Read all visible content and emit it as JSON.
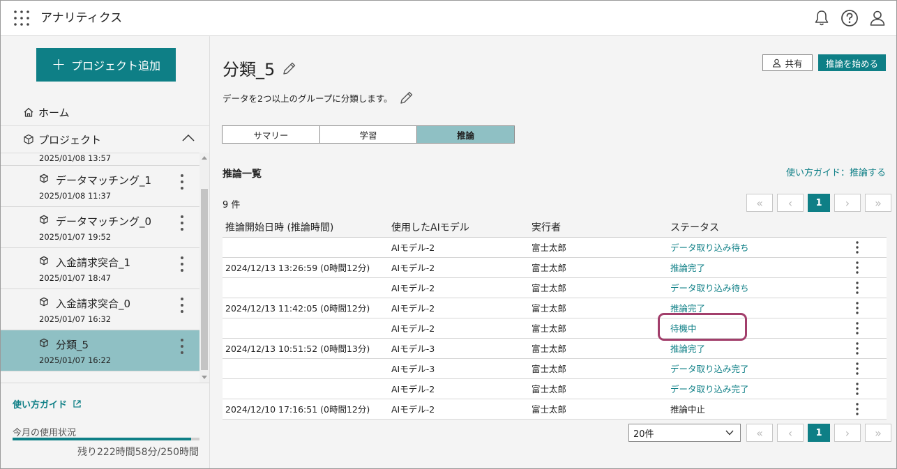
{
  "app": {
    "title": "アナリティクス"
  },
  "colors": {
    "accent": "#0e7f86",
    "active_bg": "#8fc0c4",
    "highlight": "#a23e6b"
  },
  "header": {
    "icons": [
      "apps-grid-icon",
      "bell-icon",
      "help-icon",
      "user-icon"
    ]
  },
  "sidebar": {
    "add_project": "プロジェクト追加",
    "home": "ホーム",
    "projects": "プロジェクト",
    "partial_date": "2025/01/08 13:57",
    "items": [
      {
        "name": "データマッチング_1",
        "date": "2025/01/08 11:37"
      },
      {
        "name": "データマッチング_0",
        "date": "2025/01/07 19:52"
      },
      {
        "name": "入金請求突合_1",
        "date": "2025/01/07 18:47"
      },
      {
        "name": "入金請求突合_0",
        "date": "2025/01/07 16:32"
      },
      {
        "name": "分類_5",
        "date": "2025/01/07 16:22"
      }
    ],
    "guide": "使い方ガイド",
    "usage_label": "今月の使用状況",
    "usage_fraction": 0.957,
    "usage_remain": "残り222時間58分/250時間"
  },
  "main": {
    "project_title": "分類_5",
    "description": "データを2つ以上のグループに分類します。",
    "share": "共有",
    "start": "推論を始める",
    "tabs": [
      "サマリー",
      "学習",
      "推論"
    ],
    "section_title": "推論一覧",
    "guide_link": "使い方ガイド：推論する",
    "count": "9 件",
    "current_page": "1",
    "per_page": "20件",
    "columns": [
      "推論開始日時 (推論時間)",
      "使用したAIモデル",
      "実行者",
      "ステータス"
    ],
    "rows": [
      {
        "start": "",
        "model": "AIモデル-2",
        "user": "富士太郎",
        "status": "データ取り込み待ち"
      },
      {
        "start": "2024/12/13 13:26:59 (0時間12分)",
        "model": "AIモデル-2",
        "user": "富士太郎",
        "status": "推論完了"
      },
      {
        "start": "",
        "model": "AIモデル-2",
        "user": "富士太郎",
        "status": "データ取り込み待ち"
      },
      {
        "start": "2024/12/13 11:42:05 (0時間12分)",
        "model": "AIモデル-2",
        "user": "富士太郎",
        "status": "推論完了"
      },
      {
        "start": "",
        "model": "AIモデル-2",
        "user": "富士太郎",
        "status": "待機中"
      },
      {
        "start": "2024/12/13 10:51:52 (0時間13分)",
        "model": "AIモデル-3",
        "user": "富士太郎",
        "status": "推論完了"
      },
      {
        "start": "",
        "model": "AIモデル-3",
        "user": "富士太郎",
        "status": "データ取り込み完了"
      },
      {
        "start": "",
        "model": "AIモデル-2",
        "user": "富士太郎",
        "status": "データ取り込み完了"
      },
      {
        "start": "2024/12/10 17:16:51 (0時間12分)",
        "model": "AIモデル-2",
        "user": "富士太郎",
        "status": "推論中止"
      }
    ]
  }
}
